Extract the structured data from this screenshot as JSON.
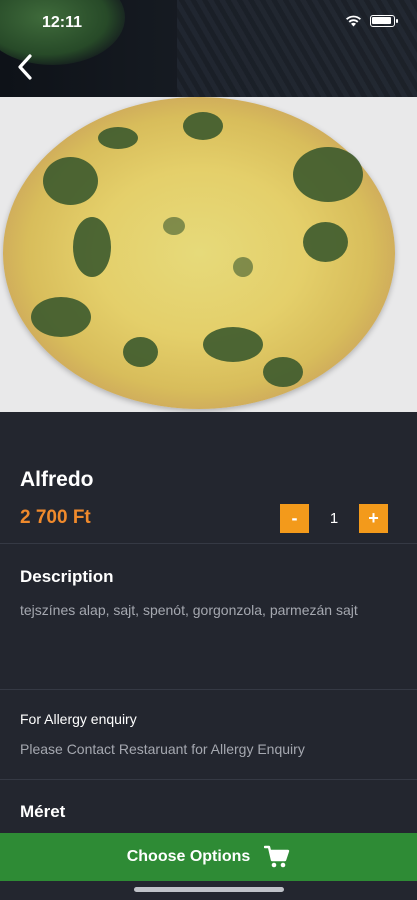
{
  "status_bar": {
    "time": "12:11",
    "wifi_icon": "wifi-icon",
    "battery_icon": "battery-icon"
  },
  "nav": {
    "back_icon": "chevron-left-icon"
  },
  "product": {
    "name": "Alfredo",
    "price": "2 700 Ft",
    "quantity": "1",
    "decrement_label": "-",
    "increment_label": "+"
  },
  "description": {
    "heading": "Description",
    "text": "tejszínes alap, sajt, spenót, gorgonzola, parmezán sajt"
  },
  "allergy": {
    "heading": "For Allergy enquiry",
    "text": "Please Contact Restaruant for Allergy Enquiry"
  },
  "size_section": {
    "heading": "Méret"
  },
  "cta": {
    "label": "Choose Options",
    "icon": "cart-icon"
  },
  "colors": {
    "background": "#23262f",
    "price": "#f08a2c",
    "stepper": "#f39a1b",
    "cta": "#2e8b35"
  }
}
